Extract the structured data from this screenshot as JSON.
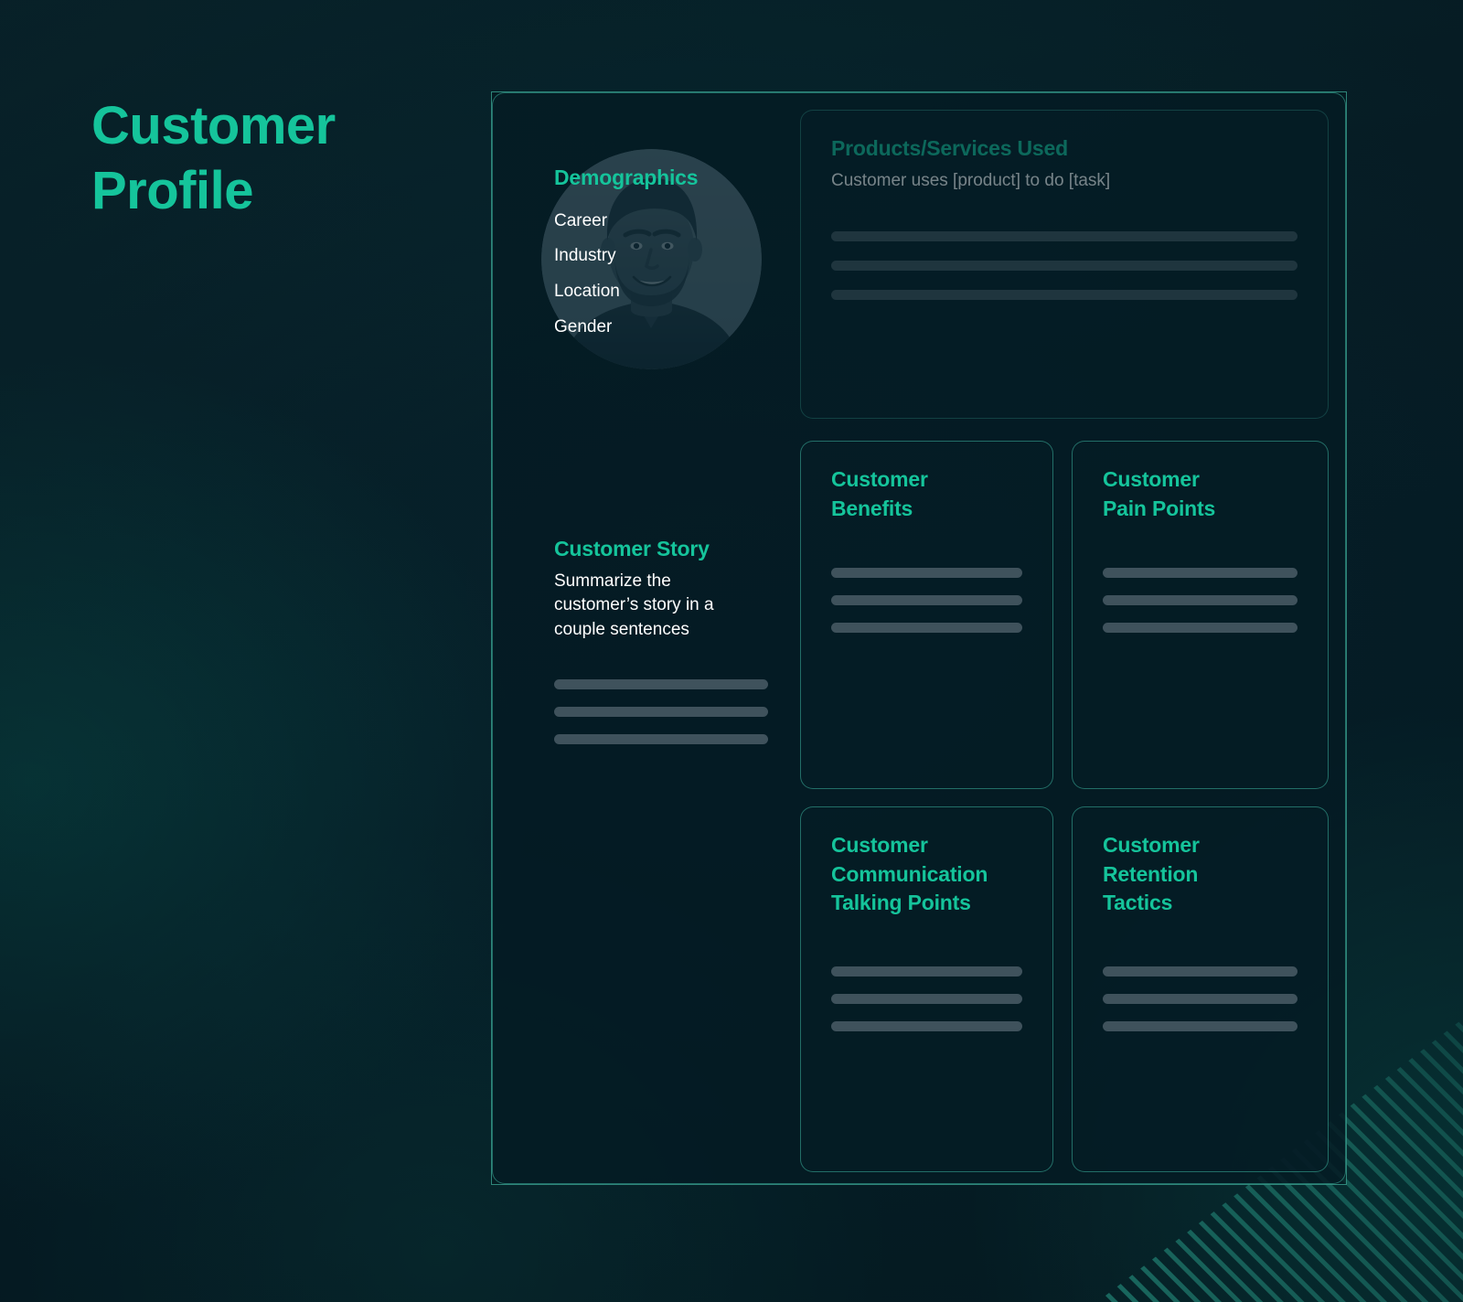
{
  "page": {
    "title": "Customer Profile",
    "title_line1": "Customer",
    "title_line2": "Profile",
    "accent_color": "#15c49b",
    "text_color": "#ffffff",
    "background_color": "#07222b",
    "panel_border_color": "#48c8b0",
    "placeholder_bar_color": "#3f525c"
  },
  "avatar": {
    "alt": "customer headshot photo",
    "shape": "circle"
  },
  "cards": {
    "products": {
      "heading": "Products/Services Used",
      "subtitle": "Customer uses [product] to do [task]",
      "placeholder_lines": 3
    },
    "demographics": {
      "heading": "Demographics",
      "items": [
        "Career",
        "Industry",
        "Location",
        "Gender"
      ]
    },
    "benefits": {
      "heading": "Customer\nBenefits",
      "placeholder_lines": 3
    },
    "pain_points": {
      "heading": "Customer\nPain Points",
      "placeholder_lines": 3
    },
    "customer_story": {
      "heading": "Customer Story",
      "subtitle": "Summarize the\ncustomer’s story in a\ncouple sentences",
      "placeholder_lines": 3
    },
    "communication": {
      "heading": "Customer\nCommunication\nTalking Points",
      "placeholder_lines": 3
    },
    "retention": {
      "heading": "Customer\nRetention\nTactics",
      "placeholder_lines": 3
    }
  },
  "decoration": {
    "stripes_corner": "bottom-right",
    "stripes_angle_deg": 45,
    "stripes_color": "#2aa894"
  }
}
